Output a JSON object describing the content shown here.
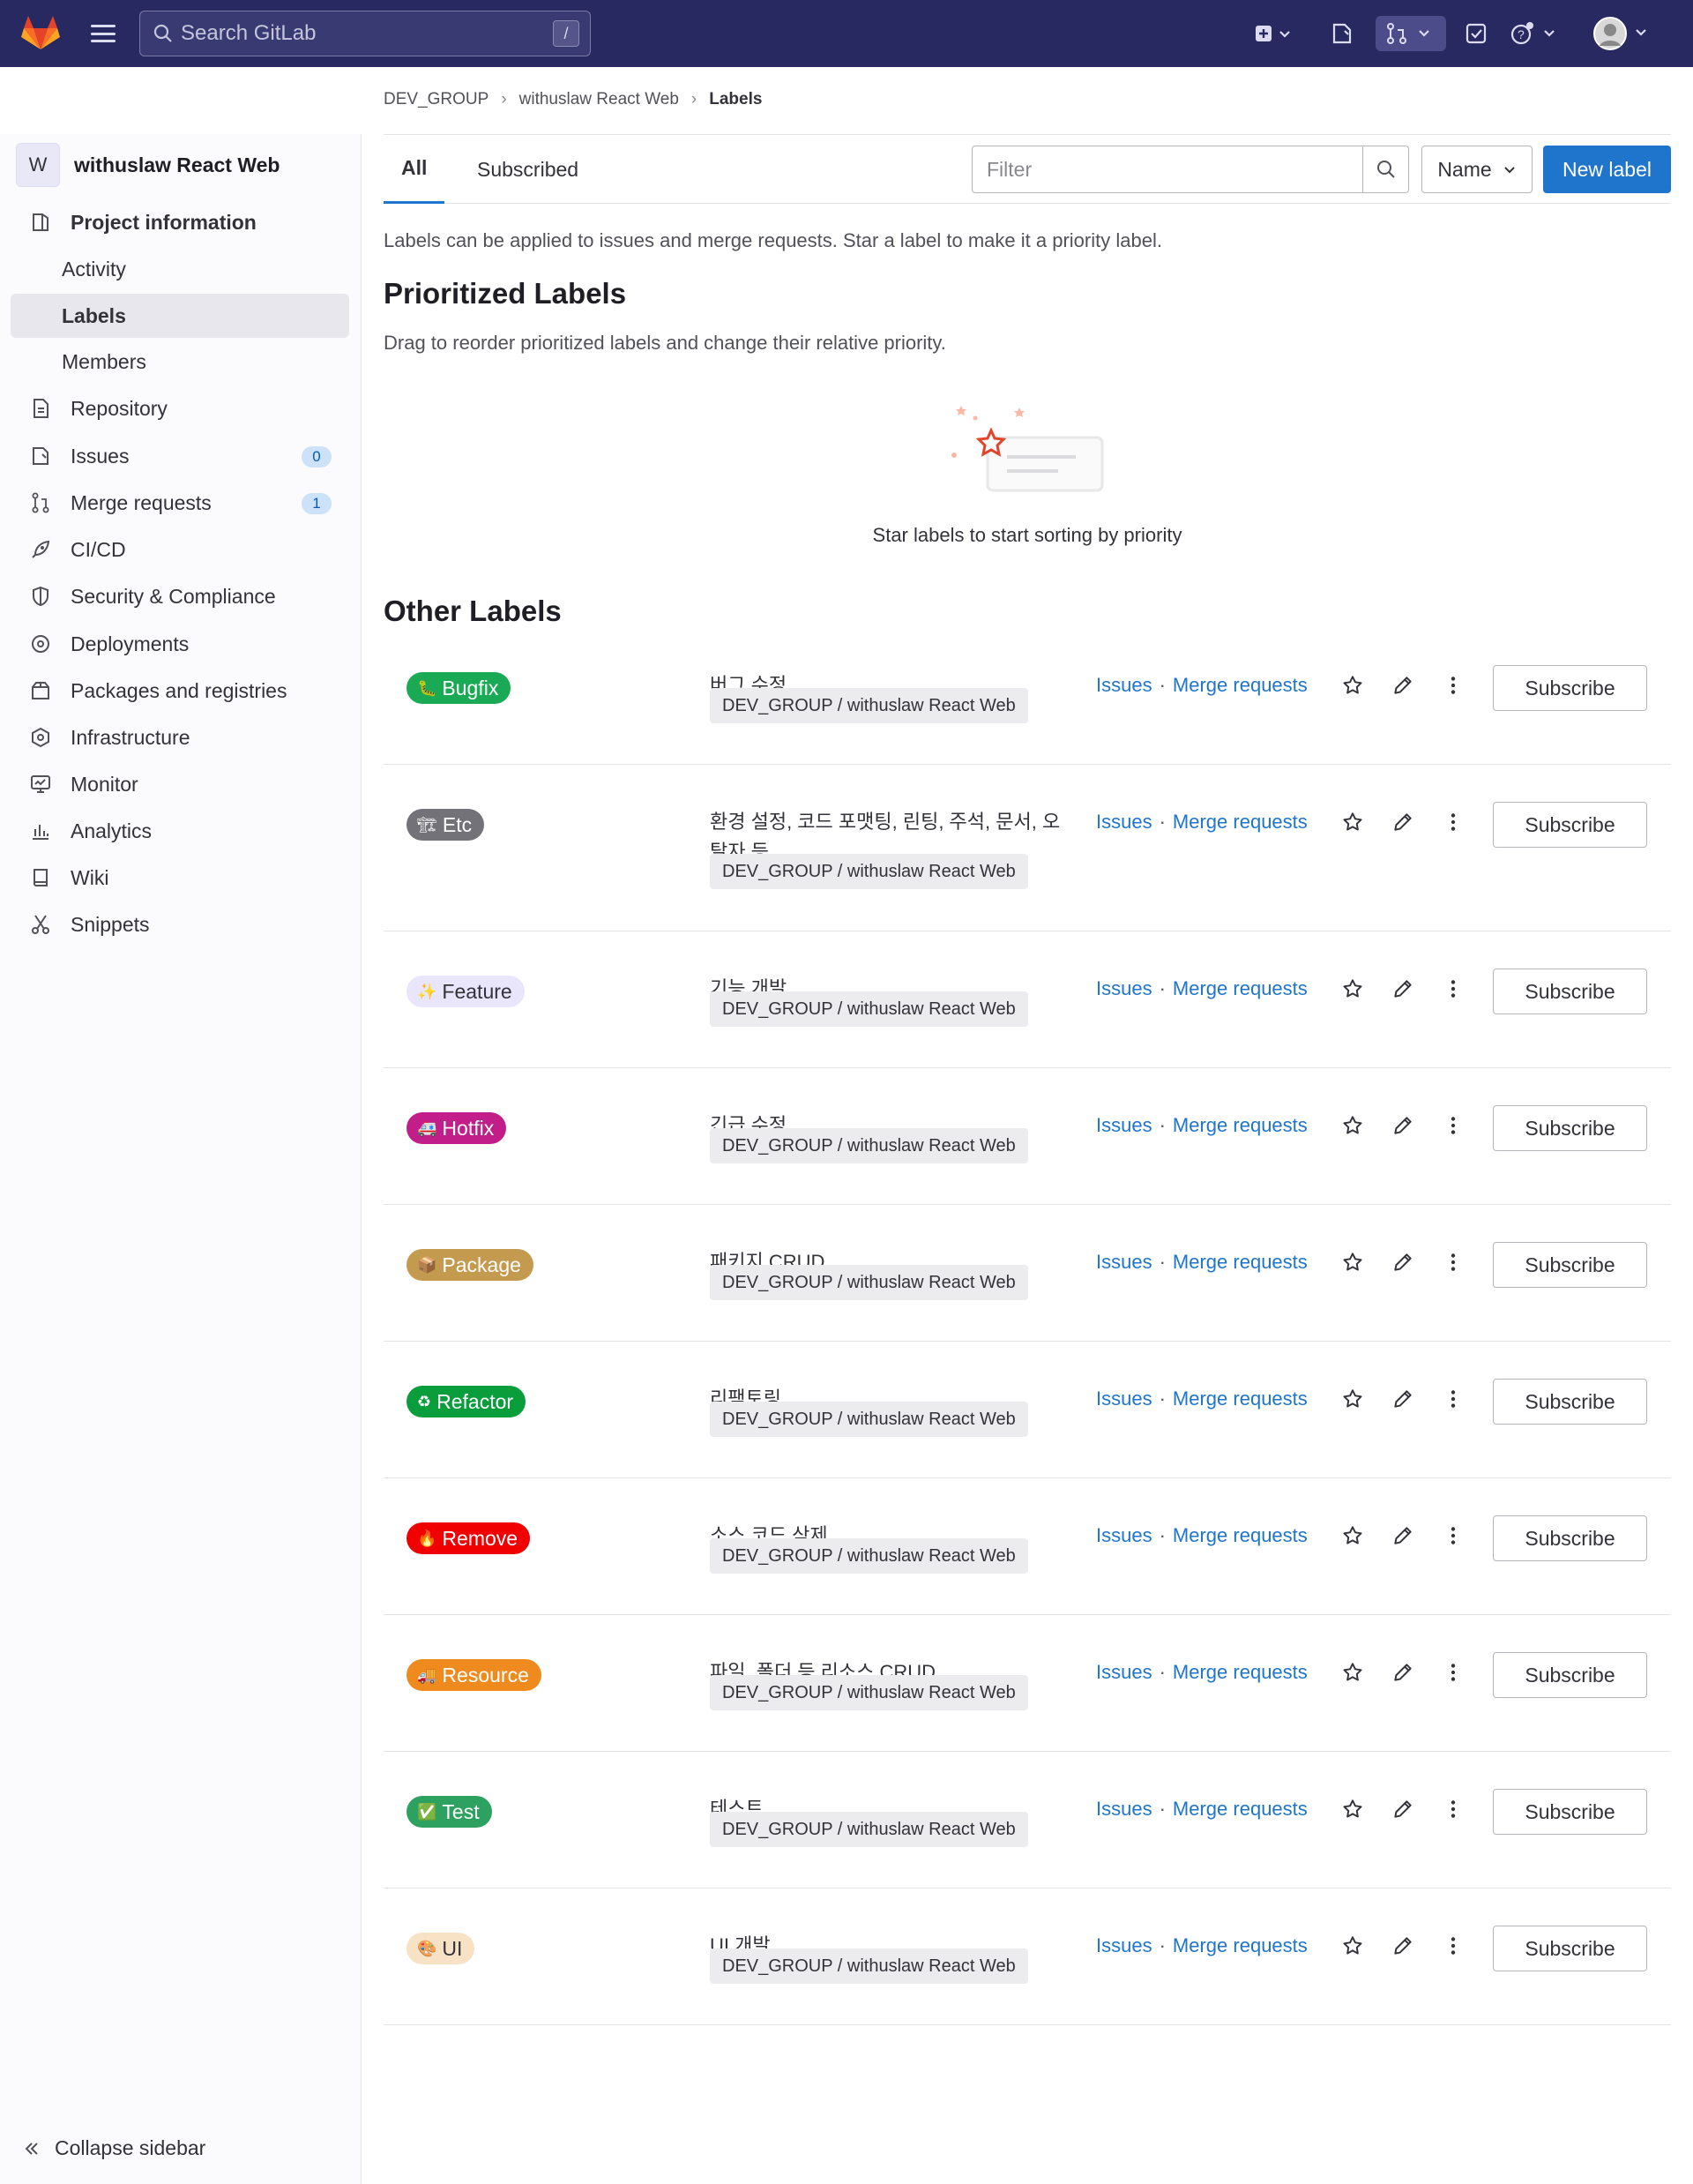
{
  "topbar": {
    "search_placeholder": "Search GitLab",
    "search_shortcut": "/"
  },
  "breadcrumb": [
    "DEV_GROUP",
    "withuslaw React Web",
    "Labels"
  ],
  "sidebar": {
    "project_initial": "W",
    "project_name": "withuslaw React Web",
    "items": [
      {
        "label": "Project information",
        "icon": "info-icon"
      },
      {
        "label": "Activity"
      },
      {
        "label": "Labels"
      },
      {
        "label": "Members"
      },
      {
        "label": "Repository",
        "icon": "doc-icon"
      },
      {
        "label": "Issues",
        "icon": "issues-icon",
        "badge": "0"
      },
      {
        "label": "Merge requests",
        "icon": "merge-request-icon",
        "badge": "1"
      },
      {
        "label": "CI/CD",
        "icon": "rocket-icon"
      },
      {
        "label": "Security & Compliance",
        "icon": "shield-icon"
      },
      {
        "label": "Deployments",
        "icon": "deployments-icon"
      },
      {
        "label": "Packages and registries",
        "icon": "package-icon"
      },
      {
        "label": "Infrastructure",
        "icon": "cloud-icon"
      },
      {
        "label": "Monitor",
        "icon": "monitor-icon"
      },
      {
        "label": "Analytics",
        "icon": "chart-icon"
      },
      {
        "label": "Wiki",
        "icon": "book-icon"
      },
      {
        "label": "Snippets",
        "icon": "scissors-icon"
      }
    ],
    "collapse_label": "Collapse sidebar"
  },
  "tabs": [
    "All",
    "Subscribed"
  ],
  "filter_placeholder": "Filter",
  "sort_label": "Name",
  "new_label_button": "New label",
  "intro": "Labels can be applied to issues and merge requests. Star a label to make it a priority label.",
  "prioritized": {
    "title": "Prioritized Labels",
    "description": "Drag to reorder prioritized labels and change their relative priority.",
    "empty_text": "Star labels to start sorting by priority"
  },
  "other": {
    "title": "Other Labels",
    "issues_link": "Issues",
    "separator": "·",
    "mr_link": "Merge requests",
    "subscribe_label": "Subscribe",
    "labels": [
      {
        "name": "Bugfix",
        "emoji": "🐛",
        "bg": "#1aaa55",
        "fg": "#ffffff",
        "description": "버그 수정",
        "scope": "DEV_GROUP / withuslaw React Web"
      },
      {
        "name": "Etc",
        "emoji": "🏗",
        "bg": "#737278",
        "fg": "#ffffff",
        "description": "환경 설정, 코드 포맷팅, 린팅, 주석, 문서, 오탈자 등",
        "scope": "DEV_GROUP / withuslaw React Web"
      },
      {
        "name": "Feature",
        "emoji": "✨",
        "bg": "#e9e5fb",
        "fg": "#333238",
        "description": "기능 개발",
        "scope": "DEV_GROUP / withuslaw React Web"
      },
      {
        "name": "Hotfix",
        "emoji": "🚑",
        "bg": "#c21e8a",
        "fg": "#ffffff",
        "description": "긴급 수정",
        "scope": "DEV_GROUP / withuslaw React Web"
      },
      {
        "name": "Package",
        "emoji": "📦",
        "bg": "#c49a4e",
        "fg": "#ffffff",
        "description": "패키지 CRUD",
        "scope": "DEV_GROUP / withuslaw React Web"
      },
      {
        "name": "Refactor",
        "emoji": "♻",
        "bg": "#0a9d3b",
        "fg": "#ffffff",
        "description": "리팩토링",
        "scope": "DEV_GROUP / withuslaw React Web"
      },
      {
        "name": "Remove",
        "emoji": "🔥",
        "bg": "#f00000",
        "fg": "#ffffff",
        "description": "소스 코드 삭제",
        "scope": "DEV_GROUP / withuslaw React Web"
      },
      {
        "name": "Resource",
        "emoji": "🚚",
        "bg": "#ef8a1f",
        "fg": "#ffffff",
        "description": "파일, 폴더 등 리소스 CRUD",
        "scope": "DEV_GROUP / withuslaw React Web"
      },
      {
        "name": "Test",
        "emoji": "✅",
        "bg": "#2da160",
        "fg": "#ffffff",
        "description": "테스트",
        "scope": "DEV_GROUP / withuslaw React Web"
      },
      {
        "name": "UI",
        "emoji": "🎨",
        "bg": "#f7e2c6",
        "fg": "#333238",
        "description": "UI 개발",
        "scope": "DEV_GROUP / withuslaw React Web"
      }
    ]
  }
}
